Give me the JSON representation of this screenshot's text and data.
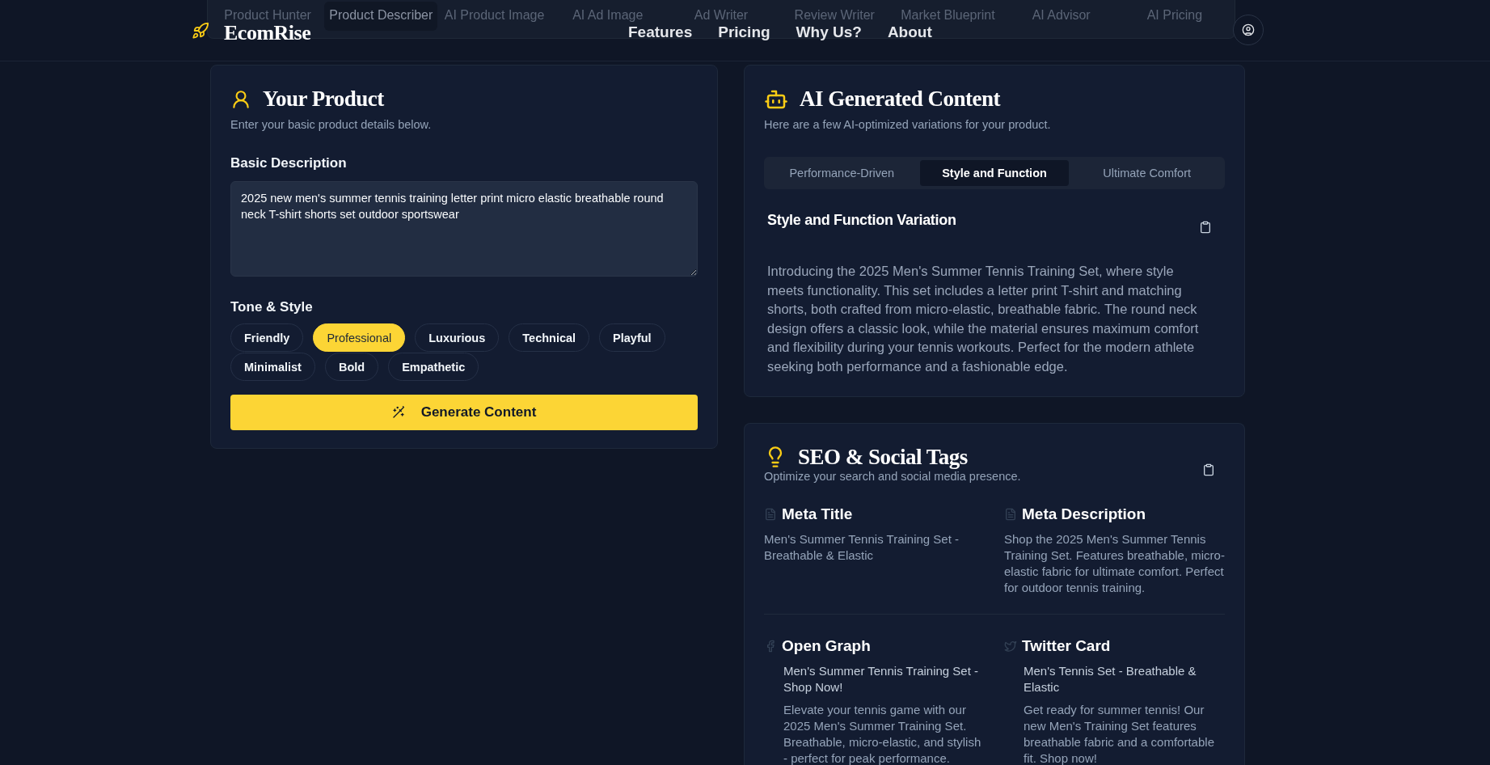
{
  "tool_strip": {
    "tabs": [
      {
        "label": "Product Hunter",
        "selected": false
      },
      {
        "label": "Product Describer",
        "selected": true
      },
      {
        "label": "AI Product Image",
        "selected": false
      },
      {
        "label": "AI Ad Image",
        "selected": false
      },
      {
        "label": "Ad Writer",
        "selected": false
      },
      {
        "label": "Review Writer",
        "selected": false
      },
      {
        "label": "Market Blueprint",
        "selected": false
      },
      {
        "label": "AI Advisor",
        "selected": false
      },
      {
        "label": "AI Pricing",
        "selected": false
      }
    ]
  },
  "header": {
    "brand": "EcomRise",
    "nav": [
      "Features",
      "Pricing",
      "Why Us?",
      "About"
    ]
  },
  "product_card": {
    "title": "Your Product",
    "subtitle": "Enter your basic product details below.",
    "description_label": "Basic Description",
    "description_value": "2025 new men's summer tennis training letter print micro elastic breathable round neck T-shirt shorts set outdoor sportswear",
    "tone_label": "Tone & Style",
    "tones": [
      {
        "label": "Friendly",
        "selected": false
      },
      {
        "label": "Professional",
        "selected": true
      },
      {
        "label": "Luxurious",
        "selected": false
      },
      {
        "label": "Technical",
        "selected": false
      },
      {
        "label": "Playful",
        "selected": false
      },
      {
        "label": "Minimalist",
        "selected": false
      },
      {
        "label": "Bold",
        "selected": false
      },
      {
        "label": "Empathetic",
        "selected": false
      }
    ],
    "generate_button": "Generate Content"
  },
  "ai_card": {
    "title": "AI Generated Content",
    "subtitle": "Here are a few AI-optimized variations for your product.",
    "tabs": [
      {
        "label": "Performance-Driven",
        "selected": false
      },
      {
        "label": "Style and Function",
        "selected": true
      },
      {
        "label": "Ultimate Comfort",
        "selected": false
      }
    ],
    "variation_title": "Style and Function Variation",
    "variation_text": "Introducing the 2025 Men's Summer Tennis Training Set, where style meets functionality. This set includes a letter print T-shirt and matching shorts, both crafted from micro-elastic, breathable fabric. The round neck design offers a classic look, while the material ensures maximum comfort and flexibility during your tennis workouts. Perfect for the modern athlete seeking both performance and a fashionable edge."
  },
  "seo_card": {
    "title": "SEO & Social Tags",
    "subtitle": "Optimize your search and social media presence.",
    "sections": [
      {
        "kind": "meta",
        "title": "Meta Title",
        "text": "Men's Summer Tennis Training Set - Breathable & Elastic"
      },
      {
        "kind": "meta",
        "title": "Meta Description",
        "text": "Shop the 2025 Men's Summer Tennis Training Set. Features breathable, micro-elastic fabric for ultimate comfort. Perfect for outdoor tennis training."
      },
      {
        "kind": "social",
        "title": "Open Graph",
        "headline": "Men's Summer Tennis Training Set - Shop Now!",
        "text": "Elevate your tennis game with our 2025 Men's Summer Training Set. Breathable, micro-elastic, and stylish - perfect for peak performance."
      },
      {
        "kind": "social",
        "title": "Twitter Card",
        "headline": "Men's Tennis Set - Breathable & Elastic",
        "text": "Get ready for summer tennis! Our new Men's Training Set features breathable fabric and a comfortable fit. Shop now!"
      }
    ]
  }
}
